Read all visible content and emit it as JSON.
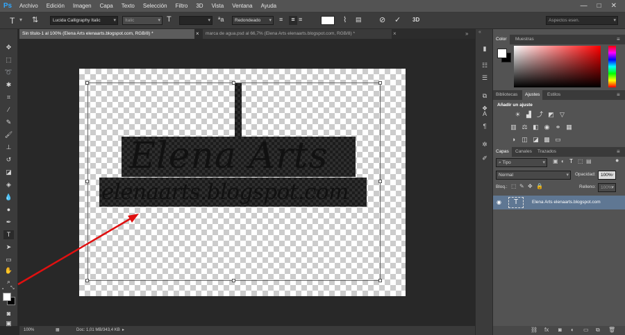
{
  "app": {
    "logo": "Ps",
    "menu": [
      "Archivo",
      "Edición",
      "Imagen",
      "Capa",
      "Texto",
      "Selección",
      "Filtro",
      "3D",
      "Vista",
      "Ventana",
      "Ayuda"
    ],
    "window_buttons": [
      "—",
      "□",
      "✕"
    ]
  },
  "options_bar": {
    "font_family": "Lucida Calligraphy Italic",
    "font_style": "Italic",
    "font_size": "",
    "aa_label": "ªa",
    "antialias": "Redondeado",
    "threed_label": "3D",
    "workspace": "Aspectos esen."
  },
  "tabs": [
    {
      "label": "Sin título-1 al 100% (Elena Arts elenaarts.blogspot.com, RGB/8) *",
      "close": "×"
    },
    {
      "label": "marca de agua.psd al 66,7% (Elena Arts elenaarts.blogspot.com, RGB/8) *",
      "close": "×"
    }
  ],
  "canvas": {
    "title_text": "Elena Arts",
    "url_text": "elenaarts.blogspot.com"
  },
  "status": {
    "zoom": "100%",
    "doc_info": "Doc: 1,01 MB/343,4 KB"
  },
  "color_panel": {
    "tabs": [
      "Color",
      "Muestras"
    ]
  },
  "adjust_panel": {
    "tabs": [
      "Bibliotecas",
      "Ajustes",
      "Estilos"
    ],
    "heading": "Añadir un ajuste"
  },
  "layers_panel": {
    "tabs": [
      "Capas",
      "Canales",
      "Trazados"
    ],
    "filter": "Tipo",
    "blend_mode": "Normal",
    "opacity_label": "Opacidad:",
    "opacity_value": "100%",
    "lock_label": "Bloq.:",
    "fill_label": "Relleno:",
    "fill_value": "100%",
    "layers": [
      {
        "name": "Elena Arts elenaarts.blogspot.com",
        "thumb": "T"
      }
    ]
  },
  "colors": {
    "accent_arrow": "#e01010",
    "ps_blue": "#31a8ff",
    "layer_selected": "#5f7793"
  }
}
